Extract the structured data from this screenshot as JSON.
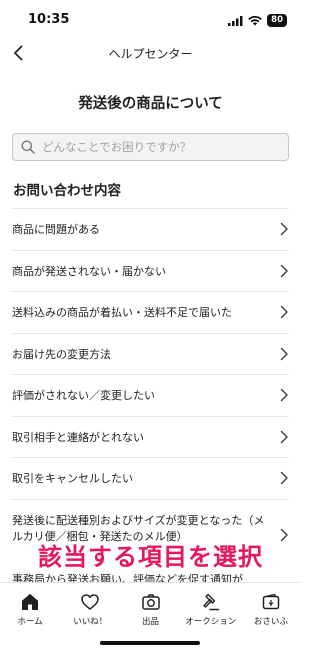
{
  "status_bar": {
    "time": "10:35",
    "battery": "80",
    "icons": [
      "signal-icon",
      "wifi-icon",
      "battery-icon"
    ]
  },
  "nav": {
    "back_icon": "chevron-left-icon",
    "title": "ヘルプセンター"
  },
  "page": {
    "title": "発送後の商品について"
  },
  "search": {
    "placeholder": "どんなことでお困りですか？",
    "value": ""
  },
  "contact": {
    "section_title": "お問い合わせ内容",
    "items": [
      {
        "label": "商品に問題がある"
      },
      {
        "label": "商品が発送されない・届かない"
      },
      {
        "label": "送料込みの商品が着払い・送料不足で届いた"
      },
      {
        "label": "お届け先の変更方法"
      },
      {
        "label": "評価がされない／変更したい"
      },
      {
        "label": "取引相手と連絡がとれない"
      },
      {
        "label": "取引をキャンセルしたい"
      },
      {
        "label": "発送後に配送種別およびサイズが変更となった（メルカリ便／梱包・発送たのメル便）"
      }
    ]
  },
  "overlay": {
    "caption": "該当する項目を選択",
    "color": "#e8175a"
  },
  "partial_text": "事務局から発送お願い、評価などを促す通知が",
  "tabs": [
    {
      "label": "ホーム",
      "icon": "home-icon",
      "active": true
    },
    {
      "label": "いいね！",
      "icon": "heart-icon",
      "active": false
    },
    {
      "label": "出品",
      "icon": "camera-icon",
      "active": false
    },
    {
      "label": "オークション",
      "icon": "gavel-icon",
      "active": false
    },
    {
      "label": "おさいふ",
      "icon": "wallet-icon",
      "active": false
    }
  ]
}
